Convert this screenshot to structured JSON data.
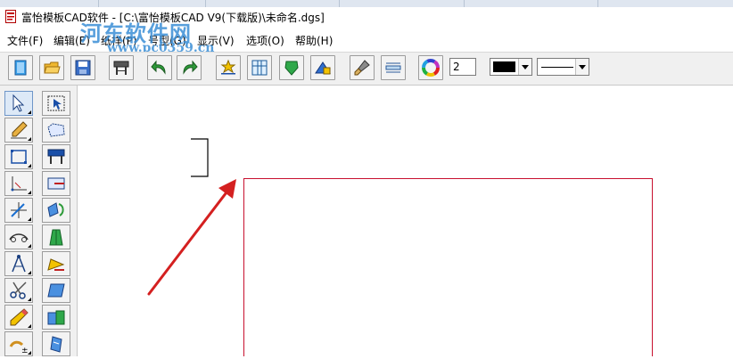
{
  "window": {
    "title": "富怡模板CAD软件 - [C:\\富怡模板CAD V9(下载版)\\未命名.dgs]",
    "app_icon": "document-icon"
  },
  "watermark": {
    "text": "河东软件网",
    "url": "www.pc0359.cn"
  },
  "menu": [
    {
      "label": "文件(F)"
    },
    {
      "label": "编辑(E)"
    },
    {
      "label": "纸样(P)"
    },
    {
      "label": "号型(G)"
    },
    {
      "label": "显示(V)"
    },
    {
      "label": "选项(O)"
    },
    {
      "label": "帮助(H)"
    }
  ],
  "toolbar": {
    "buttons": [
      "new-file",
      "open-file",
      "save-file",
      "plotter",
      "undo",
      "redo",
      "mark-points",
      "pattern-view",
      "shield",
      "lock",
      "brush",
      "ruler-panel",
      "color-wheel"
    ],
    "line_width_value": "2",
    "color_value": "#000000"
  },
  "left_tools": [
    "select-arrow",
    "pen",
    "rectangle",
    "corner-axis",
    "crosshair",
    "measure-curve",
    "compass",
    "scissors",
    "pencil",
    "plus-minus",
    "select-box",
    "pattern-piece",
    "plotter-small",
    "edit-dart",
    "rotate-copy",
    "body-figure",
    "fill-color",
    "transform",
    "fold-tool",
    "layers"
  ],
  "colors": {
    "accent": "#c8102e",
    "arrow": "#d42020",
    "watermark": "#3c8fd6"
  }
}
